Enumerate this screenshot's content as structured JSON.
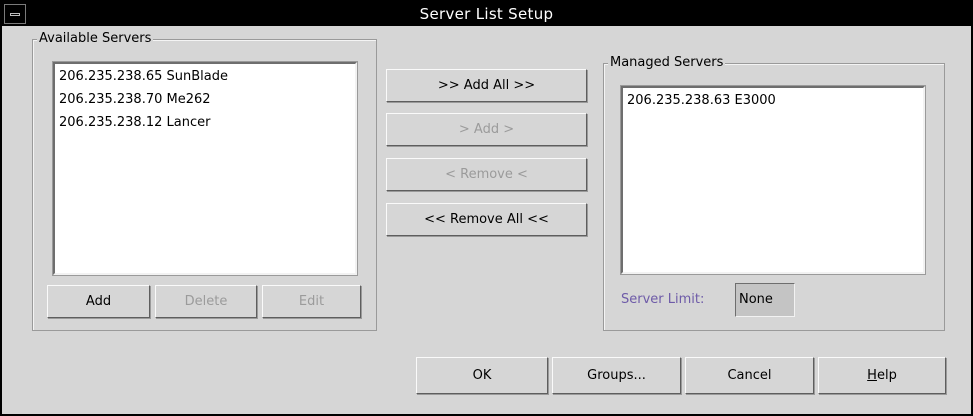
{
  "window": {
    "title": "Server List Setup",
    "menu_icon": "window-menu-icon"
  },
  "available": {
    "legend": "Available Servers",
    "items": [
      "206.235.238.65 SunBlade",
      "206.235.238.70 Me262",
      "206.235.238.12 Lancer"
    ],
    "buttons": {
      "add": "Add",
      "delete": "Delete",
      "edit": "Edit"
    }
  },
  "transfer": {
    "add_all": ">> Add All >>",
    "add": "> Add >",
    "remove": "< Remove <",
    "remove_all": "<< Remove All <<"
  },
  "managed": {
    "legend": "Managed Servers",
    "items": [
      "206.235.238.63 E3000"
    ],
    "limit_label": "Server Limit:",
    "limit_value": "None"
  },
  "footer": {
    "ok": "OK",
    "groups": "Groups...",
    "cancel": "Cancel",
    "help_mnemonic": "H",
    "help_rest": "elp"
  },
  "colors": {
    "title_bar": "#000000",
    "dialog_bg": "#d6d6d6",
    "limit_label": "#6e5ba8",
    "disabled_text": "#9b9b9b"
  }
}
